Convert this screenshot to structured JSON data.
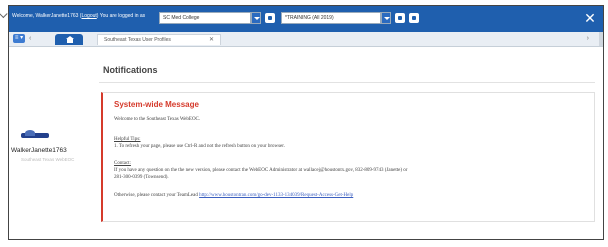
{
  "header": {
    "welcome_prefix": "Welcome, WalkerJanette1763",
    "logout_link": "Logout",
    "context_text": "You are logged in as",
    "role_select_value": "SC Med College",
    "incident_select_value": "*TRAINING (All 2019)"
  },
  "tabs": {
    "menu_label": "≡ ▾",
    "prev_label": "‹",
    "home_tab": "home",
    "document_tab": "Southeast Texas User Profiles",
    "next_label": "›"
  },
  "user": {
    "username": "WalkerJanette1763",
    "organization": "Southeast Texas WebEOC"
  },
  "main": {
    "title": "Notifications",
    "message": {
      "heading": "System-wide Message",
      "welcome": "Welcome to the Southeast Texas WebEOC.",
      "tips_label": "Helpful Tips:",
      "tip_1": "1.  To refresh your page, please use Ctrl-R and not the refresh button on your browser.",
      "contact_label": "Contact:",
      "contact_line_1": "If you have any question on the the new version, please contact the WebEOC Administrator at wallacej@houstontx.gov, 832-809-9743 (Janette) or",
      "contact_line_2": "281-300-0399 (Townsend).",
      "other_prefix": "Otherwise, please contact your TeamLead",
      "other_link": "http://www.houstontran.com/go-dev-1133-134039/Request-Access-Get-Help"
    }
  },
  "colors": {
    "brand_blue": "#1f5fae",
    "alert_red": "#d53a2b"
  },
  "icons": {
    "tools": "wrench-icon",
    "home": "home-icon",
    "avatar": "emergency-logo-icon"
  }
}
